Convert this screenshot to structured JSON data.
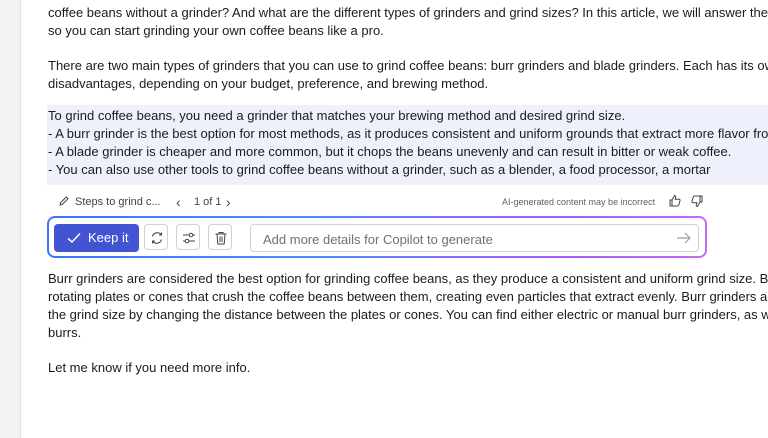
{
  "document": {
    "intro_lines": [
      "coffee beans without a grinder? And what are the different types of grinders and grind sizes? In this article, we will answer these qu",
      "so you can start grinding your own coffee beans like a pro."
    ],
    "para2_lines": [
      "There are two main types of grinders that you can use to grind coffee beans: burr grinders and blade grinders. Each has its own adv",
      "disadvantages, depending on your budget, preference, and brewing method."
    ],
    "generated_lines": [
      "To grind coffee beans, you need a grinder that matches your brewing method and desired grind size.",
      "- A burr grinder is the best option for most methods, as it produces consistent and uniform grounds that extract more flavor from t",
      "- A blade grinder is cheaper and more common, but it chops the beans unevenly and can result in bitter or weak coffee.",
      "- You can also use other tools to grind coffee beans without a grinder, such as a blender, a food processor, a mortar"
    ],
    "para_burr_lines": [
      "Burr grinders are considered the best option for grinding coffee beans, as they produce a consistent and uniform grind size. Burr g",
      "rotating plates or cones that crush the coffee beans between them, creating even particles that extract evenly. Burr grinders also all",
      "the grind size by changing the distance between the plates or cones. You can find either electric or manual burr grinders, as well as",
      "burrs."
    ],
    "closing": "Let me know if you need more info."
  },
  "copilot": {
    "steps_label": "Steps to grind c...",
    "pager": "1 of 1",
    "disclaimer": "AI-generated content may be incorrect",
    "keep_label": "Keep it",
    "prompt_placeholder": "Add more details for Copilot to generate",
    "icons": [
      "pencil-icon",
      "chevron-left-icon",
      "chevron-right-icon",
      "thumbs-up-icon",
      "thumbs-down-icon",
      "checkmark-icon",
      "regenerate-icon",
      "adjust-icon",
      "trash-icon",
      "send-icon"
    ],
    "accent": "#4354d3",
    "highlight": "#eef0fb"
  }
}
